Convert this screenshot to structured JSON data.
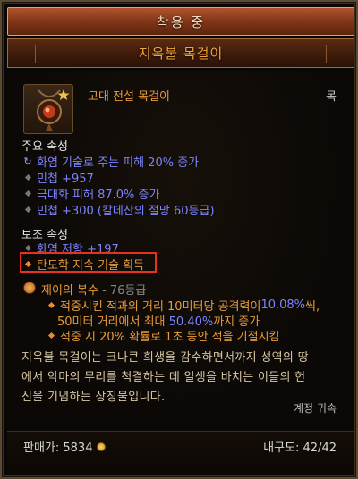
{
  "header": {
    "equipped_label": "착용 중",
    "item_name": "지옥불 목걸이"
  },
  "item": {
    "type": "고대 전설 목걸이",
    "slot": "목",
    "icon": "amulet-icon"
  },
  "primary": {
    "title": "주요 속성",
    "affixes": [
      "화염 기술로 주는 피해 20% 증가",
      "민첩 +957",
      "극대화 피해 87.0% 증가",
      "민첩 +300 (칼데산의 절망 60등급)"
    ]
  },
  "secondary": {
    "title": "보조 속성",
    "affixes": [
      "화염 저항 +197",
      "탄도학 지속 기술 획득"
    ]
  },
  "legendary_gem": {
    "name": "제이의 복수",
    "rank": "- 76등급",
    "line1_pre": "적중시킨 적과의 거리 10미터당 공격력이 ",
    "line1_num": "10.08%",
    "line1_post": "씩,",
    "line2_pre": "50미터 거리에서 최대 ",
    "line2_num": "50.40%",
    "line2_post": "까지 증가",
    "line3": "적중 시 20% 확률로 1초 동안 적을 기절시킴"
  },
  "flavor": {
    "line1": "지옥불 목걸이는 크나큰 희생을 감수하면서까지 성역의 땅",
    "line2": "에서 악마의 무리를 척결하는 데 일생을 바치는 이들의 헌",
    "line3": "신을 기념하는 상징물입니다."
  },
  "bind": "계정 귀속",
  "footer": {
    "sell_label": "판매가: 5834",
    "durability": "내구도: 42/42"
  },
  "colors": {
    "legendary": "#e59a3a",
    "magic": "#7d83ff",
    "highlight": "#e8321e"
  }
}
